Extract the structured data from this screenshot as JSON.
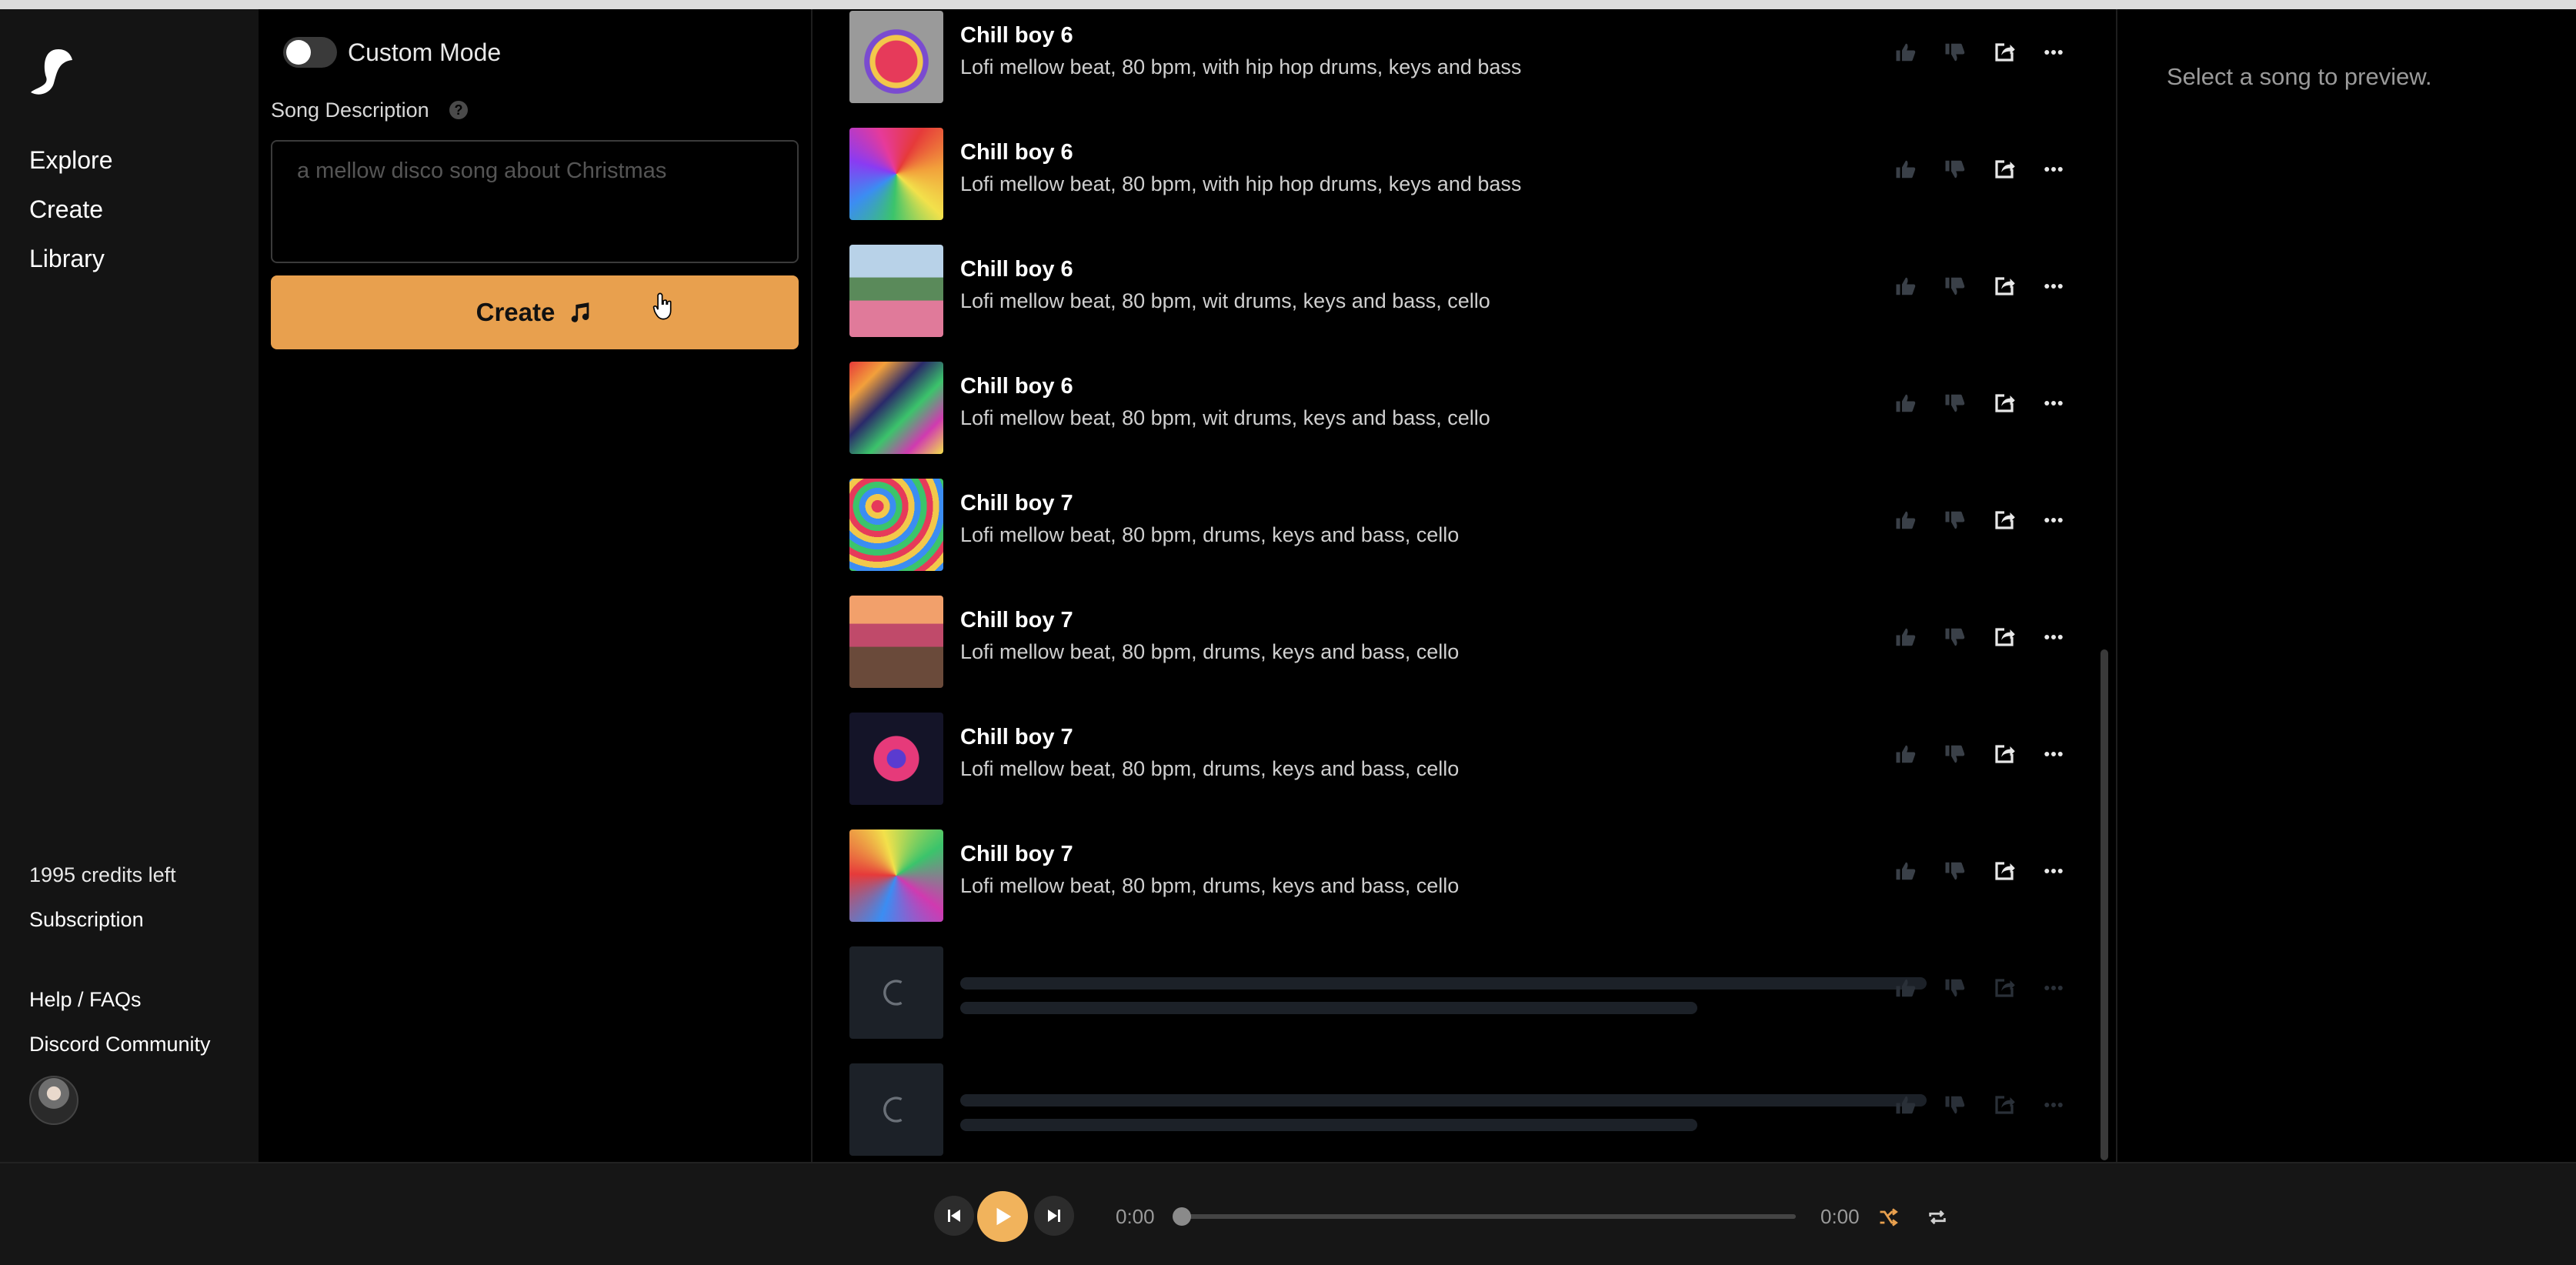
{
  "sidebar": {
    "nav": [
      "Explore",
      "Create",
      "Library"
    ],
    "credits": "1995 credits left",
    "subscription": "Subscription",
    "help": "Help / FAQs",
    "discord": "Discord Community"
  },
  "create_panel": {
    "custom_mode_label": "Custom Mode",
    "custom_mode_on": false,
    "description_label": "Song Description",
    "description_placeholder": "a mellow disco song about Christmas",
    "description_value": "",
    "create_label": "Create"
  },
  "songs": [
    {
      "title": "Chill boy 6",
      "description": "Lofi mellow beat, 80 bpm, with hip hop drums, keys and bass",
      "art": "flower-heart"
    },
    {
      "title": "Chill boy 6",
      "description": "Lofi mellow beat, 80 bpm, with hip hop drums, keys and bass",
      "art": "swirl"
    },
    {
      "title": "Chill boy 6",
      "description": "Lofi mellow beat, 80 bpm, wit drums, keys and bass, cello",
      "art": "landscape"
    },
    {
      "title": "Chill boy 6",
      "description": "Lofi mellow beat, 80 bpm, wit drums, keys and bass, cello",
      "art": "rainbow-waves"
    },
    {
      "title": "Chill boy 7",
      "description": "Lofi mellow beat, 80 bpm, drums, keys and bass, cello",
      "art": "hearts"
    },
    {
      "title": "Chill boy 7",
      "description": "Lofi mellow beat, 80 bpm, drums, keys and bass, cello",
      "art": "sunset-path"
    },
    {
      "title": "Chill boy 7",
      "description": "Lofi mellow beat, 80 bpm, drums, keys and bass, cello",
      "art": "dark-heart"
    },
    {
      "title": "Chill boy 7",
      "description": "Lofi mellow beat, 80 bpm, drums, keys and bass, cello",
      "art": "color-swirl"
    }
  ],
  "loading_rows": 2,
  "preview": {
    "empty_text": "Select a song to preview."
  },
  "player": {
    "current_time": "0:00",
    "total_time": "0:00",
    "progress": 0
  },
  "colors": {
    "accent": "#e8a04e",
    "play_button": "#f1b35c",
    "sidebar_bg": "#141414",
    "background": "#000000"
  }
}
